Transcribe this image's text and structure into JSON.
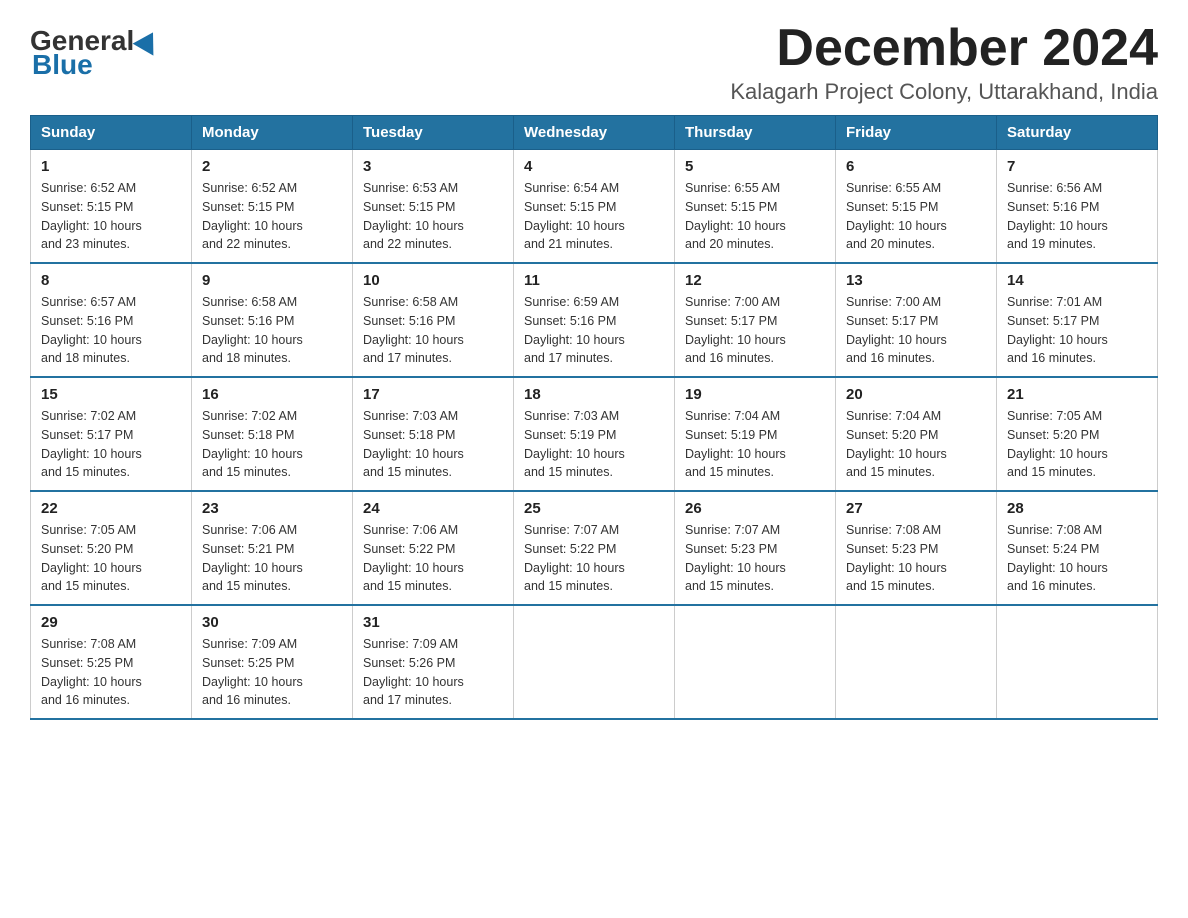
{
  "header": {
    "logo_general": "General",
    "logo_blue": "Blue",
    "month_title": "December 2024",
    "location": "Kalagarh Project Colony, Uttarakhand, India"
  },
  "days_of_week": [
    "Sunday",
    "Monday",
    "Tuesday",
    "Wednesday",
    "Thursday",
    "Friday",
    "Saturday"
  ],
  "weeks": [
    [
      {
        "day": "1",
        "sunrise": "6:52 AM",
        "sunset": "5:15 PM",
        "daylight": "10 hours and 23 minutes."
      },
      {
        "day": "2",
        "sunrise": "6:52 AM",
        "sunset": "5:15 PM",
        "daylight": "10 hours and 22 minutes."
      },
      {
        "day": "3",
        "sunrise": "6:53 AM",
        "sunset": "5:15 PM",
        "daylight": "10 hours and 22 minutes."
      },
      {
        "day": "4",
        "sunrise": "6:54 AM",
        "sunset": "5:15 PM",
        "daylight": "10 hours and 21 minutes."
      },
      {
        "day": "5",
        "sunrise": "6:55 AM",
        "sunset": "5:15 PM",
        "daylight": "10 hours and 20 minutes."
      },
      {
        "day": "6",
        "sunrise": "6:55 AM",
        "sunset": "5:15 PM",
        "daylight": "10 hours and 20 minutes."
      },
      {
        "day": "7",
        "sunrise": "6:56 AM",
        "sunset": "5:16 PM",
        "daylight": "10 hours and 19 minutes."
      }
    ],
    [
      {
        "day": "8",
        "sunrise": "6:57 AM",
        "sunset": "5:16 PM",
        "daylight": "10 hours and 18 minutes."
      },
      {
        "day": "9",
        "sunrise": "6:58 AM",
        "sunset": "5:16 PM",
        "daylight": "10 hours and 18 minutes."
      },
      {
        "day": "10",
        "sunrise": "6:58 AM",
        "sunset": "5:16 PM",
        "daylight": "10 hours and 17 minutes."
      },
      {
        "day": "11",
        "sunrise": "6:59 AM",
        "sunset": "5:16 PM",
        "daylight": "10 hours and 17 minutes."
      },
      {
        "day": "12",
        "sunrise": "7:00 AM",
        "sunset": "5:17 PM",
        "daylight": "10 hours and 16 minutes."
      },
      {
        "day": "13",
        "sunrise": "7:00 AM",
        "sunset": "5:17 PM",
        "daylight": "10 hours and 16 minutes."
      },
      {
        "day": "14",
        "sunrise": "7:01 AM",
        "sunset": "5:17 PM",
        "daylight": "10 hours and 16 minutes."
      }
    ],
    [
      {
        "day": "15",
        "sunrise": "7:02 AM",
        "sunset": "5:17 PM",
        "daylight": "10 hours and 15 minutes."
      },
      {
        "day": "16",
        "sunrise": "7:02 AM",
        "sunset": "5:18 PM",
        "daylight": "10 hours and 15 minutes."
      },
      {
        "day": "17",
        "sunrise": "7:03 AM",
        "sunset": "5:18 PM",
        "daylight": "10 hours and 15 minutes."
      },
      {
        "day": "18",
        "sunrise": "7:03 AM",
        "sunset": "5:19 PM",
        "daylight": "10 hours and 15 minutes."
      },
      {
        "day": "19",
        "sunrise": "7:04 AM",
        "sunset": "5:19 PM",
        "daylight": "10 hours and 15 minutes."
      },
      {
        "day": "20",
        "sunrise": "7:04 AM",
        "sunset": "5:20 PM",
        "daylight": "10 hours and 15 minutes."
      },
      {
        "day": "21",
        "sunrise": "7:05 AM",
        "sunset": "5:20 PM",
        "daylight": "10 hours and 15 minutes."
      }
    ],
    [
      {
        "day": "22",
        "sunrise": "7:05 AM",
        "sunset": "5:20 PM",
        "daylight": "10 hours and 15 minutes."
      },
      {
        "day": "23",
        "sunrise": "7:06 AM",
        "sunset": "5:21 PM",
        "daylight": "10 hours and 15 minutes."
      },
      {
        "day": "24",
        "sunrise": "7:06 AM",
        "sunset": "5:22 PM",
        "daylight": "10 hours and 15 minutes."
      },
      {
        "day": "25",
        "sunrise": "7:07 AM",
        "sunset": "5:22 PM",
        "daylight": "10 hours and 15 minutes."
      },
      {
        "day": "26",
        "sunrise": "7:07 AM",
        "sunset": "5:23 PM",
        "daylight": "10 hours and 15 minutes."
      },
      {
        "day": "27",
        "sunrise": "7:08 AM",
        "sunset": "5:23 PM",
        "daylight": "10 hours and 15 minutes."
      },
      {
        "day": "28",
        "sunrise": "7:08 AM",
        "sunset": "5:24 PM",
        "daylight": "10 hours and 16 minutes."
      }
    ],
    [
      {
        "day": "29",
        "sunrise": "7:08 AM",
        "sunset": "5:25 PM",
        "daylight": "10 hours and 16 minutes."
      },
      {
        "day": "30",
        "sunrise": "7:09 AM",
        "sunset": "5:25 PM",
        "daylight": "10 hours and 16 minutes."
      },
      {
        "day": "31",
        "sunrise": "7:09 AM",
        "sunset": "5:26 PM",
        "daylight": "10 hours and 17 minutes."
      },
      null,
      null,
      null,
      null
    ]
  ],
  "labels": {
    "sunrise": "Sunrise:",
    "sunset": "Sunset:",
    "daylight": "Daylight:"
  }
}
